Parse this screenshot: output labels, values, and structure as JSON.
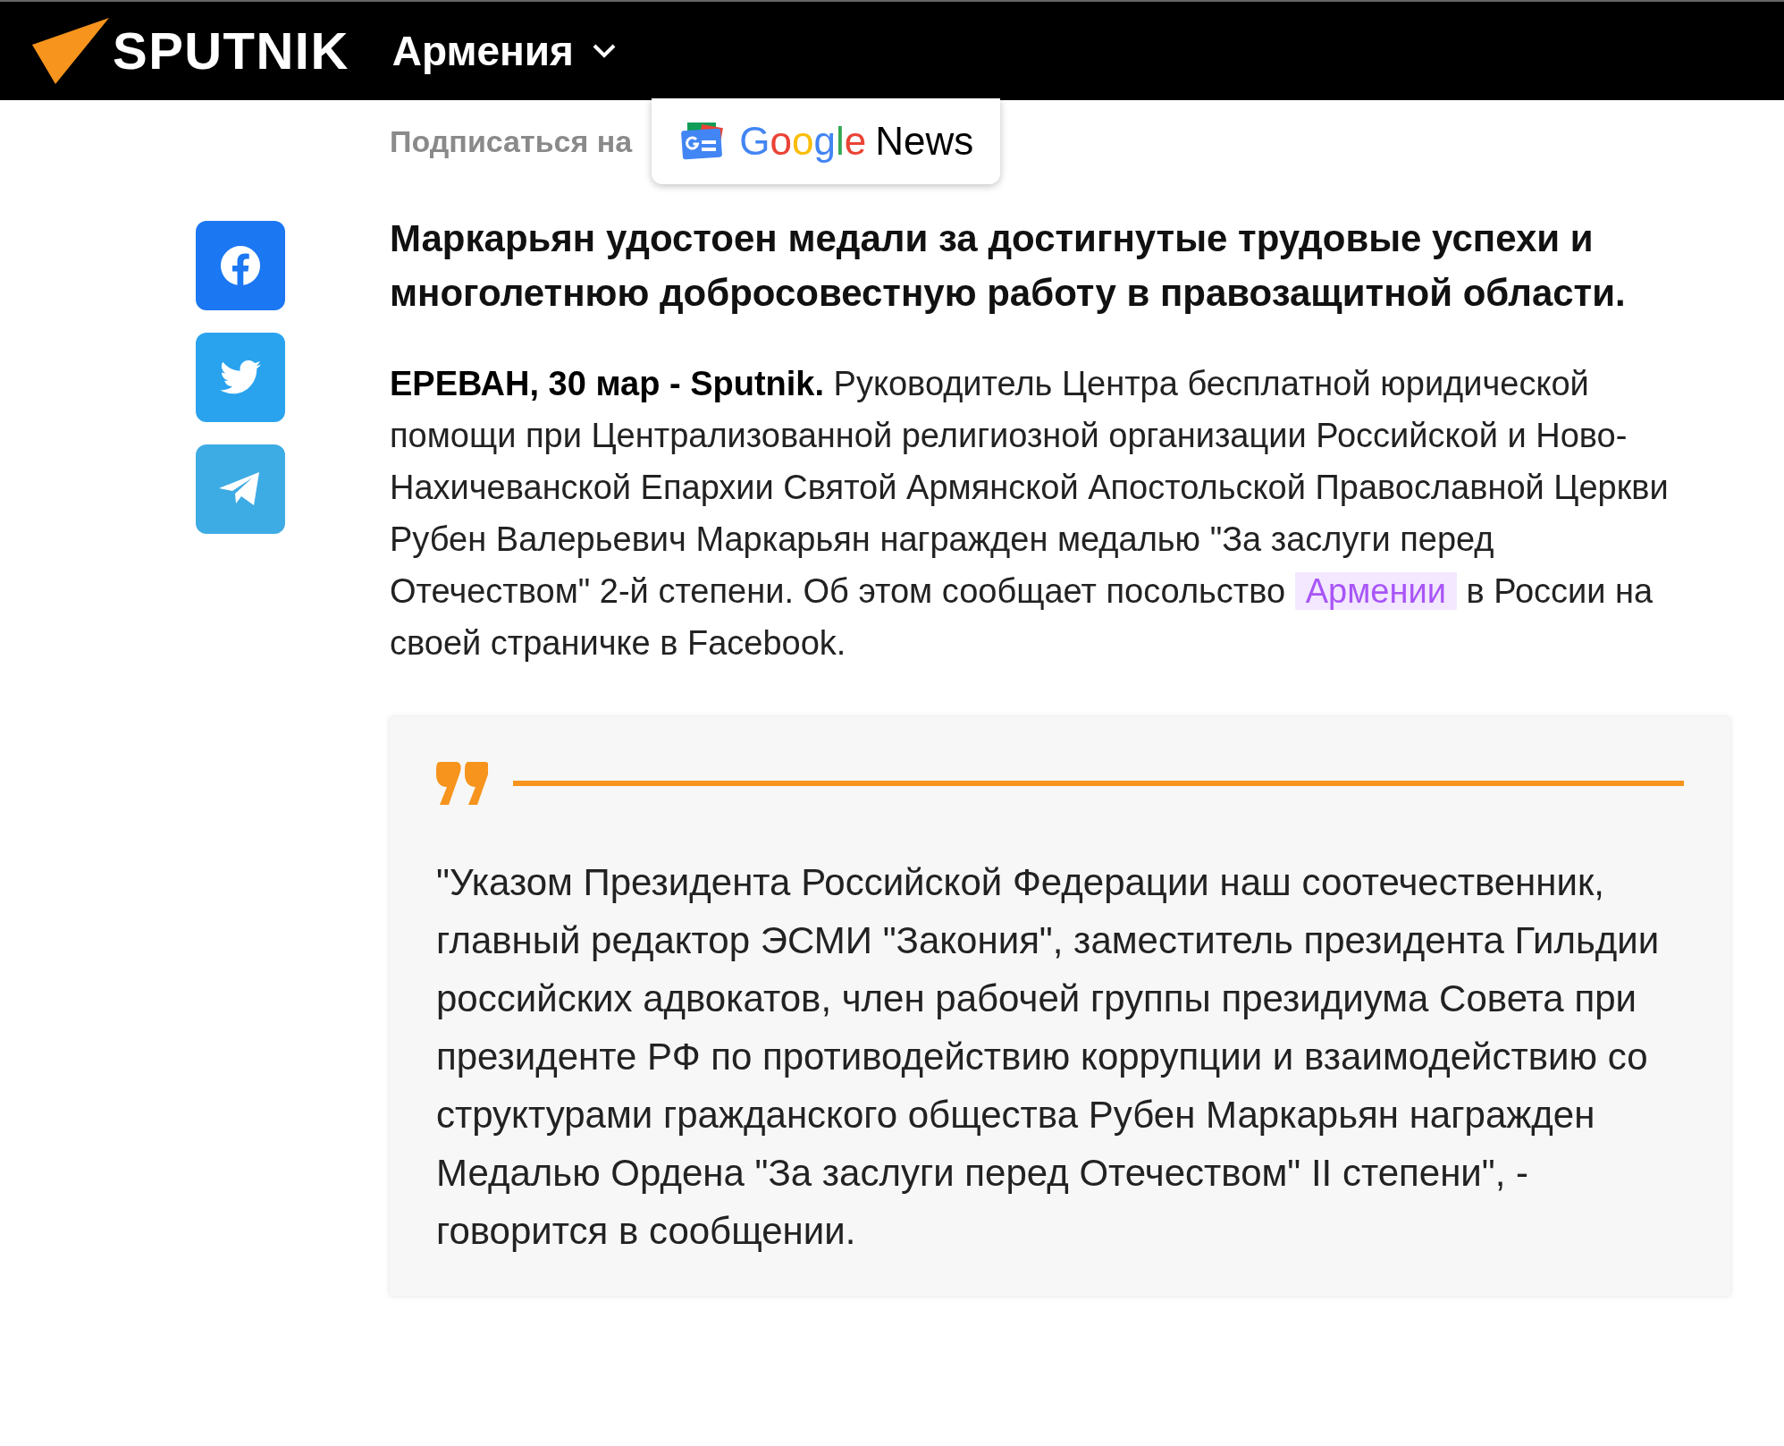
{
  "header": {
    "logo": "SPUTNIK",
    "region": "Армения"
  },
  "subscribe": {
    "label": "Подписаться на",
    "wordmark": "Google",
    "service": "News"
  },
  "share_buttons": [
    {
      "kind": "facebook",
      "color": "#1b77f2"
    },
    {
      "kind": "twitter",
      "color": "#2aa3ef"
    },
    {
      "kind": "telegram",
      "color": "#3eace4"
    }
  ],
  "article": {
    "title": "Маркарьян удостоен  медали за достигнутые трудовые успехи и многолетнюю добросовестную работу в правозащитной области.",
    "lead": "ЕРЕВАН, 30 мар - Sputnik.",
    "text_before": " Руководитель Центра бесплатной юридической помощи при Централизованной религиозной организации Российской и Ново-Нахичеванской Епархии Святой Армянской Апостольской Православной Церкви Рубен Валерьевич Маркарьян награжден медалью \"За заслуги перед Отечеством\" 2-й степени. Об этом сообщает посольство ",
    "link": "Армении",
    "text_after": " в России на своей страничке в Facebook.",
    "quote": "\"Указом Президента Российской Федерации наш соотечественник, главный редактор ЭСМИ \"Закония\", заместитель президента Гильдии российских адвокатов, член рабочей группы президиума Совета при президенте РФ по противодействию коррупции и взаимодействию со структурами гражданского общества Рубен Маркарьян награжден Медалью Ордена \"За заслуги перед Отечеством\" II степени\", - говорится в сообщении."
  }
}
